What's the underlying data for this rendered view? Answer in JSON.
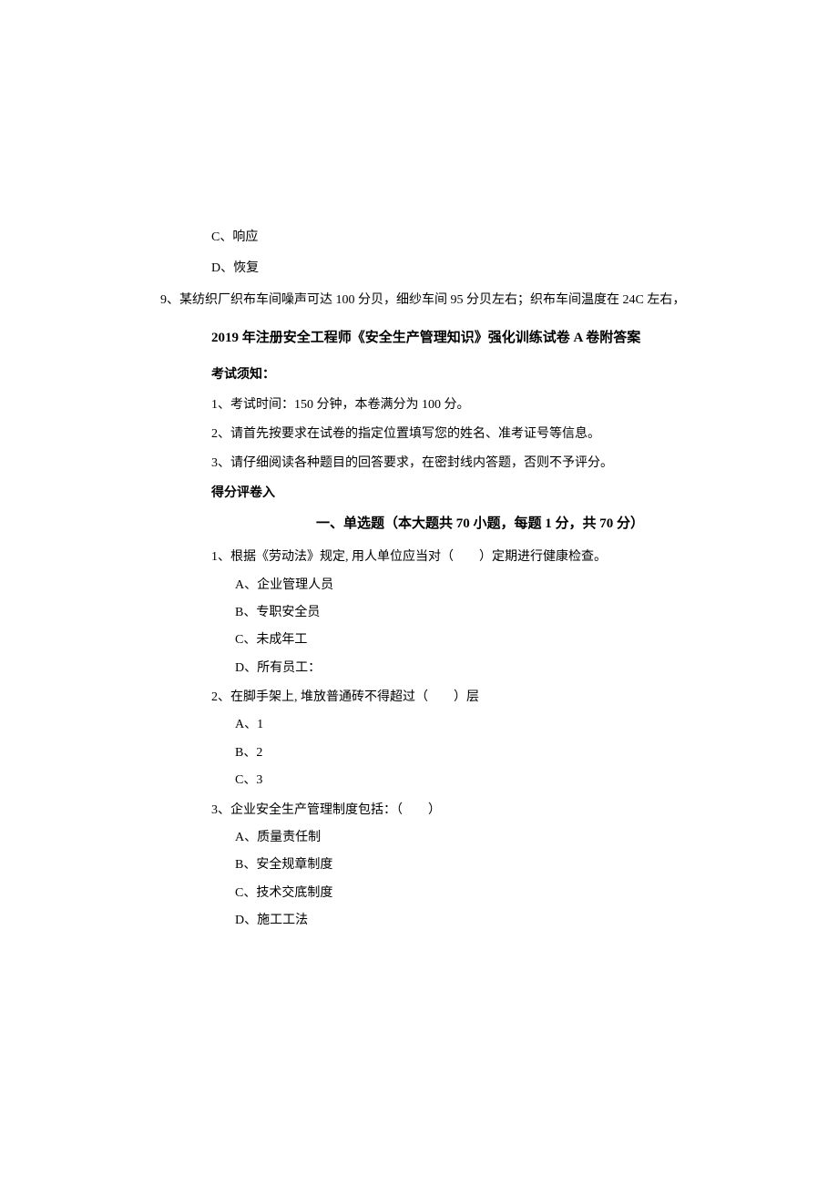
{
  "stray": {
    "optC": "C、响应",
    "optD": "D、恢复",
    "q9": "9、某纺织厂织布车间噪声可达 100 分贝，细纱车间 95 分贝左右；织布车间温度在 24C 左右，"
  },
  "title": "2019 年注册安全工程师《安全生产管理知识》强化训练试卷 A 卷附答案",
  "noticeHeading": "考试须知：",
  "notices": [
    "1、考试时间：150 分钟，本卷满分为 100 分。",
    "2、请首先按要求在试卷的指定位置填写您的姓名、准考证号等信息。",
    "3、请仔细阅读各种题目的回答要求，在密封线内答题，否则不予评分。"
  ],
  "scoreHeading": "得分评卷入",
  "sectionTitle": "一、单选题（本大题共 70 小题，每题 1 分，共 70 分）",
  "questions": [
    {
      "stem": "1、根据《劳动法》规定, 用人单位应当对（　　）定期进行健康检查。",
      "options": [
        "A、企业管理人员",
        "B、专职安全员",
        "C、未成年工",
        "D、所有员工："
      ]
    },
    {
      "stem": "2、在脚手架上, 堆放普通砖不得超过（　　）层",
      "options": [
        "A、1",
        "B、2",
        "C、3"
      ]
    },
    {
      "stem": "3、企业安全生产管理制度包括：（　　）",
      "options": [
        "A、质量责任制",
        "B、安全规章制度",
        "C、技术交底制度",
        "D、施工工法"
      ]
    }
  ]
}
